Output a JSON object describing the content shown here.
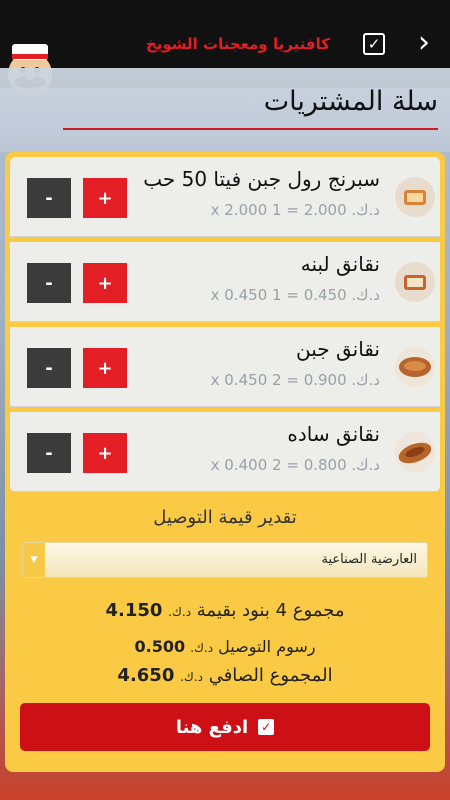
{
  "topbar": {
    "title": "كافتيريا ومعجنات الشويخ",
    "check_icon": "check-icon",
    "back_icon": "chevron-right-icon",
    "accent": "#e31e24"
  },
  "page": {
    "heading": "سلة المشتريات"
  },
  "cart": {
    "items": [
      {
        "name": "سبرنج رول جبن فيتا 50 حب",
        "price_line": "د.ك. 2.000 = 1 x 2.000",
        "minus": "-",
        "plus": "+"
      },
      {
        "name": "نقانق لبنه",
        "price_line": "د.ك. 0.450 = 1 x 0.450",
        "minus": "-",
        "plus": "+"
      },
      {
        "name": "نقانق جبن",
        "price_line": "د.ك. 0.900 = 2 x 0.450",
        "minus": "-",
        "plus": "+"
      },
      {
        "name": "نقانق ساده",
        "price_line": "د.ك. 0.800 = 2 x 0.400",
        "minus": "-",
        "plus": "+"
      }
    ],
    "delivery_label": "تقدير قيمة التوصيل",
    "delivery_area": "العارضية الصناعية",
    "summary": {
      "items_text": "مجموع 4 بنود بقيمة",
      "items_currency": "د.ك.",
      "items_total": "4.150",
      "delivery_text": "رسوم التوصيل",
      "delivery_currency": "د.ك.",
      "delivery_fee": "0.500",
      "net_text": "المجموع الصافي",
      "net_currency": "د.ك.",
      "net_total": "4.650"
    },
    "pay_label": "ادفع هنا"
  },
  "colors": {
    "brand_red": "#e31e24",
    "cart_yellow": "#fbca44",
    "pay_red": "#cc1016"
  }
}
